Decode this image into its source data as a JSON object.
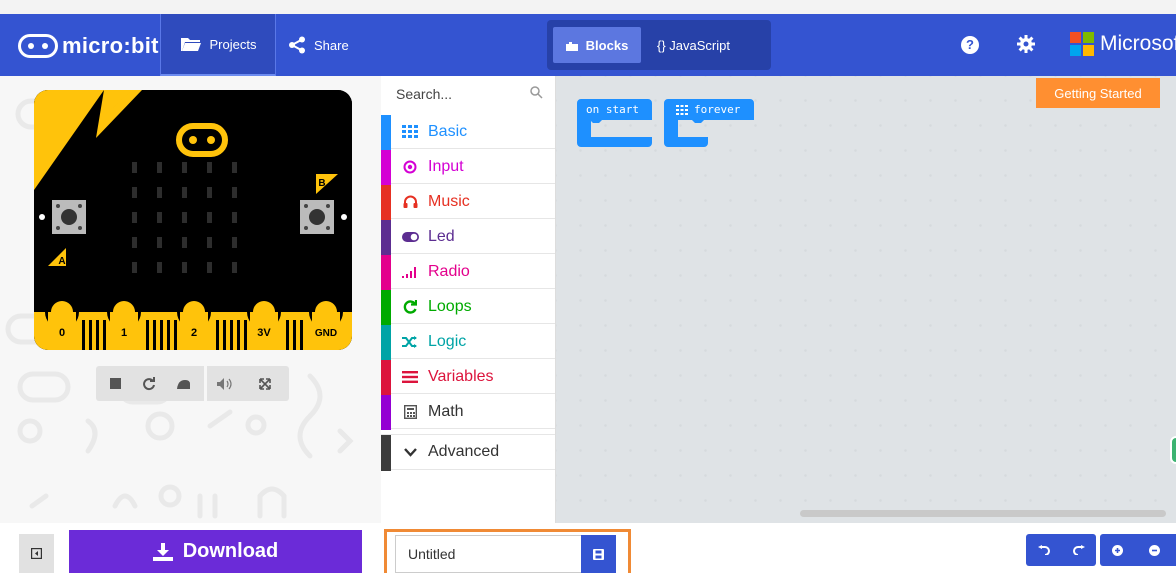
{
  "header": {
    "logo_text": "micro:bit",
    "projects_label": "Projects",
    "share_label": "Share",
    "blocks_label": "Blocks",
    "javascript_label": "{} JavaScript",
    "help_glyph": "?",
    "microsoft_label": "Microsoft",
    "colors": {
      "header_bg": "#3454d1",
      "download_bg": "#6b2bd8",
      "getting_started_bg": "#ff8f31"
    }
  },
  "simulator": {
    "pin_labels": [
      "0",
      "1",
      "2",
      "3V",
      "GND"
    ],
    "button_a_label": "A",
    "button_b_label": "B",
    "controls": [
      "stop-icon",
      "restart-icon",
      "slowmo-icon",
      "mute-icon",
      "fullscreen-icon"
    ]
  },
  "toolbox": {
    "search_placeholder": "Search...",
    "categories": [
      {
        "label": "Basic",
        "color": "#1e90ff",
        "icon": "grid-icon"
      },
      {
        "label": "Input",
        "color": "#d400d4",
        "icon": "target-icon"
      },
      {
        "label": "Music",
        "color": "#e63022",
        "icon": "headphones-icon"
      },
      {
        "label": "Led",
        "color": "#5c2d91",
        "icon": "toggle-icon"
      },
      {
        "label": "Radio",
        "color": "#e3008c",
        "icon": "signal-icon"
      },
      {
        "label": "Loops",
        "color": "#00aa00",
        "icon": "refresh-icon"
      },
      {
        "label": "Logic",
        "color": "#00a4a6",
        "icon": "shuffle-icon"
      },
      {
        "label": "Variables",
        "color": "#dc143c",
        "icon": "lines-icon"
      },
      {
        "label": "Math",
        "color": "#9400d3",
        "icon": "calculator-icon"
      }
    ],
    "advanced_label": "Advanced",
    "advanced_color": "#3c3c3c"
  },
  "workspace": {
    "blocks": [
      {
        "label": "on start"
      },
      {
        "label": "forever"
      }
    ],
    "getting_started_label": "Getting Started"
  },
  "footer": {
    "download_label": "Download",
    "project_name": "Untitled"
  }
}
